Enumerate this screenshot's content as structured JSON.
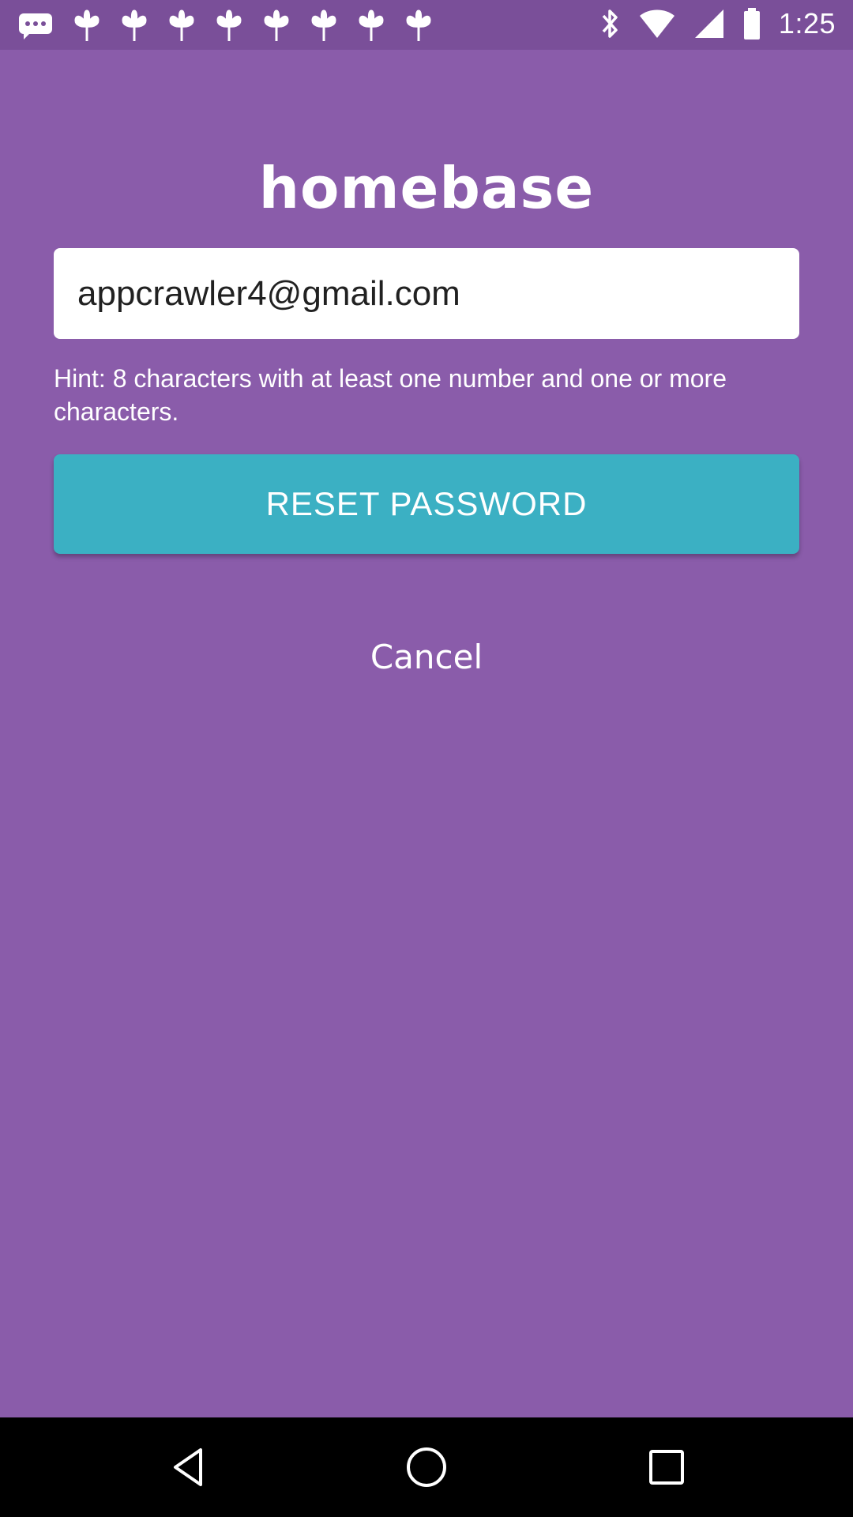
{
  "status_bar": {
    "time": "1:25",
    "left_icons": [
      "chat-icon",
      "fan-icon",
      "fan-icon",
      "fan-icon",
      "fan-icon",
      "fan-icon",
      "fan-icon",
      "fan-icon"
    ],
    "right_icons": [
      "bluetooth-icon",
      "wifi-icon",
      "cellular-signal-icon",
      "battery-icon"
    ]
  },
  "app": {
    "title": "homebase"
  },
  "form": {
    "email_value": "appcrawler4@gmail.com",
    "hint": "Hint: 8 characters with at least one number and one or more characters.",
    "reset_label": "RESET PASSWORD",
    "cancel_label": "Cancel"
  },
  "nav_bar": {
    "buttons": [
      "back-icon",
      "home-icon",
      "recents-icon"
    ]
  },
  "colors": {
    "background": "#8a5caa",
    "status_bar": "#7a4f99",
    "button": "#3bb0c3",
    "text": "#ffffff"
  }
}
